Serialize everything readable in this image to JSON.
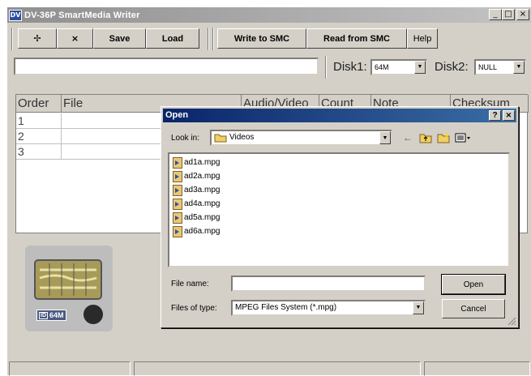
{
  "app": {
    "title": "DV-36P SmartMedia Writer",
    "icon_text": "DV"
  },
  "window_controls": {
    "minimize": "_",
    "maximize": "□",
    "close": "×"
  },
  "toolbar": {
    "add_label": "✢",
    "remove_label": "×",
    "save_label": "Save",
    "load_label": "Load",
    "write_label": "Write to SMC",
    "read_label": "Read from SMC",
    "help_label": "Help"
  },
  "disk": {
    "disk1_label": "Disk1:",
    "disk1_value": "64M",
    "disk2_label": "Disk2:",
    "disk2_value": "NULL"
  },
  "table": {
    "columns": [
      "Order",
      "File",
      "Audio/Video",
      "Count",
      "Note",
      "Checksum"
    ],
    "rows": [
      "1",
      "2",
      "3"
    ]
  },
  "card": {
    "label": "ID",
    "capacity": "64M"
  },
  "dialog": {
    "title": "Open",
    "help_btn": "?",
    "close_btn": "×",
    "look_in_label": "Look in:",
    "look_in_value": "Videos",
    "files": [
      "ad1a.mpg",
      "ad2a.mpg",
      "ad3a.mpg",
      "ad4a.mpg",
      "ad5a.mpg",
      "ad6a.mpg"
    ],
    "file_name_label": "File name:",
    "file_name_value": "",
    "files_of_type_label": "Files of type:",
    "files_of_type_value": "MPEG Files System (*.mpg)",
    "open_btn": "Open",
    "cancel_btn": "Cancel"
  }
}
